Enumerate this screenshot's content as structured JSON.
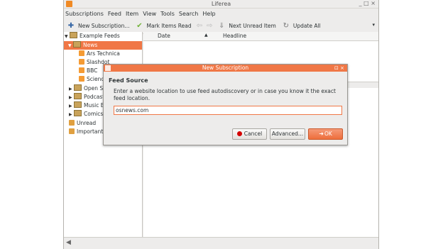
{
  "window": {
    "title": "Liferea",
    "controls": "_ □ ×"
  },
  "menu": [
    "Subscriptions",
    "Feed",
    "Item",
    "View",
    "Tools",
    "Search",
    "Help"
  ],
  "toolbar": {
    "new_subscription": "New Subscription...",
    "mark_items_read": "Mark Items Read",
    "next_unread_item": "Next Unread Item",
    "update_all": "Update All"
  },
  "feeds_tree": [
    {
      "label": "Example Feeds",
      "level": 0,
      "icon": "folder-icon",
      "expander": "open"
    },
    {
      "label": "News",
      "level": 1,
      "icon": "folder-icon",
      "expander": "open",
      "selected": true
    },
    {
      "label": "Ars Technica",
      "level": 2,
      "icon": "feed-icon"
    },
    {
      "label": "Slashdot",
      "level": 2,
      "icon": "feed-icon"
    },
    {
      "label": "BBC",
      "level": 2,
      "icon": "feed-icon"
    },
    {
      "label": "Science",
      "level": 2,
      "icon": "feed-icon"
    },
    {
      "label": "Open Sor",
      "level": 1,
      "icon": "folder-icon",
      "expander": "closed"
    },
    {
      "label": "Podcasts",
      "level": 1,
      "icon": "folder-icon",
      "expander": "closed"
    },
    {
      "label": "Music Blo",
      "level": 1,
      "icon": "folder-icon",
      "expander": "closed"
    },
    {
      "label": "Comics",
      "level": 1,
      "icon": "folder-icon",
      "expander": "closed"
    },
    {
      "label": "Unread",
      "level": 0,
      "icon": "search-folder-icon"
    },
    {
      "label": "Important",
      "level": 0,
      "icon": "search-folder-icon"
    }
  ],
  "item_list": {
    "col_date": "Date",
    "col_headline": "Headline"
  },
  "dialog": {
    "title": "New Subscription",
    "controls": "⊡ ×",
    "heading": "Feed Source",
    "description": "Enter a website location to use feed autodiscovery or in case you know it the exact feed location.",
    "url_value": "osnews.com",
    "cancel_label": "Cancel",
    "advanced_label": "Advanced...",
    "ok_label": "OK"
  },
  "colors": {
    "accent": "#f07746",
    "window_bg": "#edeceb"
  }
}
